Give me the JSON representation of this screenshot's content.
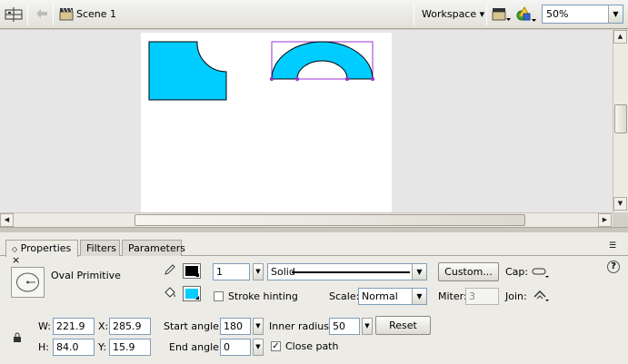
{
  "toolbar": {
    "scene_label": "Scene 1",
    "workspace_label": "Workspace ▾",
    "zoom_value": "50%"
  },
  "icons": {
    "timeline": "timeline-icon",
    "back": "back-arrow-icon",
    "scene": "clapperboard-icon",
    "edit_scene": "edit-scene-icon",
    "edit_symbols": "edit-symbols-icon",
    "pencil": "pencil-icon",
    "bucket": "paint-bucket-icon",
    "lock": "lock-icon",
    "cap": "cap-icon",
    "join": "join-icon",
    "help": "help-icon"
  },
  "colors": {
    "shape_fill": "#00ccff",
    "stroke_color": "#000000",
    "selection": "#9933cc"
  },
  "panel": {
    "tabs": [
      {
        "label": "Properties"
      },
      {
        "label": "Filters"
      },
      {
        "label": "Parameters"
      }
    ],
    "tab_close": "×",
    "tool_name": "Oval Primitive",
    "stroke_height": "1",
    "stroke_style": "Solid",
    "custom_button": "Custom...",
    "cap_label": "Cap:",
    "stroke_hinting_label": "Stroke hinting",
    "scale_label": "Scale:",
    "scale_value": "Normal",
    "miter_label": "Miter:",
    "miter_value": "3",
    "join_label": "Join:",
    "w_label": "W:",
    "w_value": "221.9",
    "x_label": "X:",
    "x_value": "285.9",
    "h_label": "H:",
    "h_value": "84.0",
    "y_label": "Y:",
    "y_value": "15.9",
    "start_angle_label": "Start angle:",
    "start_angle_value": "180",
    "end_angle_label": "End angle:",
    "end_angle_value": "0",
    "inner_radius_label": "Inner radius:",
    "inner_radius_value": "50",
    "reset_button": "Reset",
    "close_path_label": "Close path",
    "close_path_checked": true,
    "stroke_hinting_checked": false,
    "help_glyph": "?"
  }
}
